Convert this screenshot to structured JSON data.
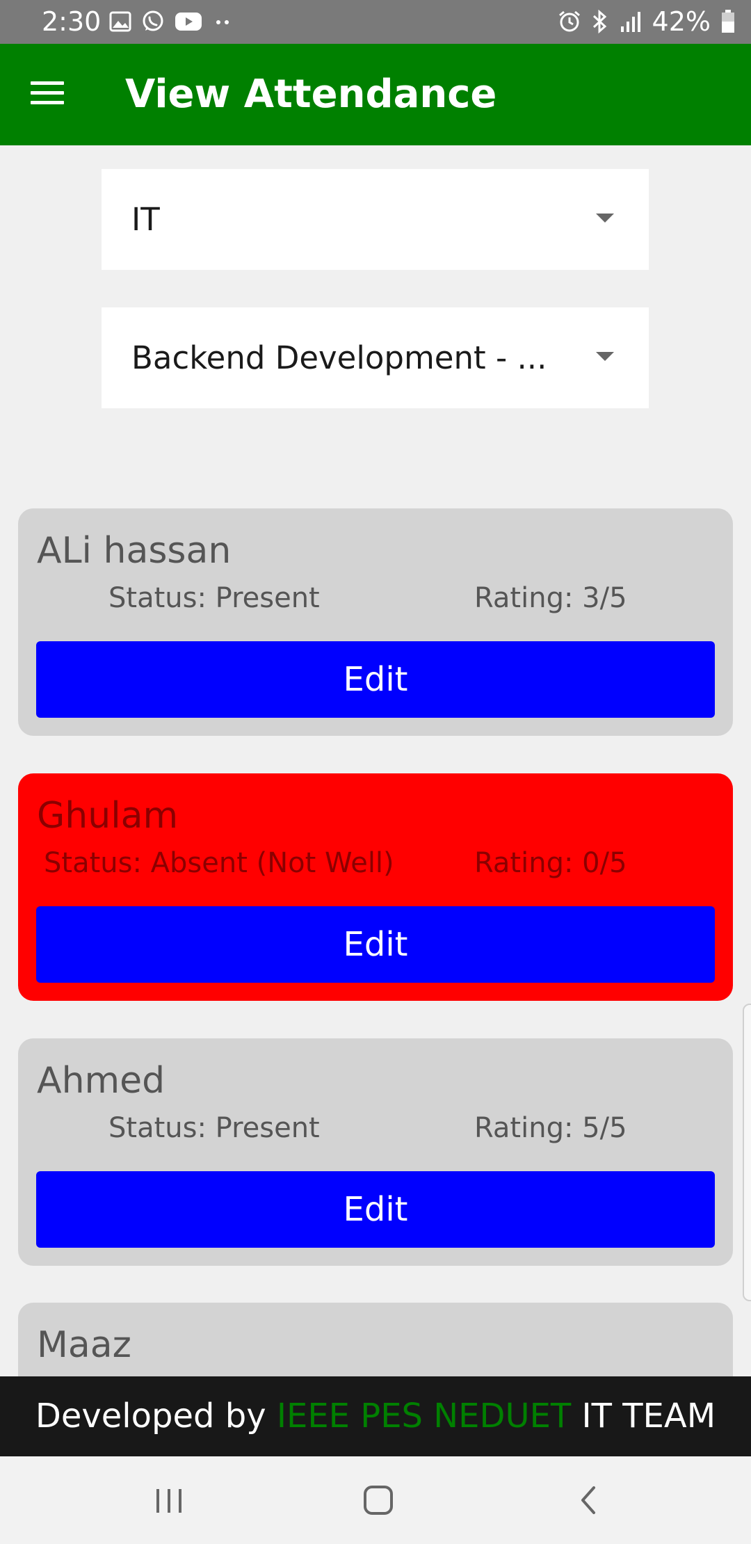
{
  "status_bar": {
    "time": "2:30",
    "battery": "42%",
    "left_icons": [
      "gallery-icon",
      "whatsapp-icon",
      "youtube-icon",
      "more-dots-icon"
    ],
    "right_icons": [
      "alarm-icon",
      "bluetooth-icon",
      "signal-icon",
      "battery-icon"
    ]
  },
  "app_bar": {
    "title": "View Attendance",
    "menu_icon": "hamburger-menu-icon",
    "color": "#008000"
  },
  "filters": {
    "department": {
      "selected": "IT"
    },
    "course": {
      "selected": "Backend Development  - ..."
    }
  },
  "records": [
    {
      "name": "ALi hassan",
      "status": "Status: Present",
      "rating": "Rating: 3/5",
      "edit_label": "Edit",
      "absent": false
    },
    {
      "name": "Ghulam",
      "status": "Status: Absent (Not Well)",
      "rating": "Rating: 0/5",
      "edit_label": "Edit",
      "absent": true
    },
    {
      "name": "Ahmed",
      "status": "Status: Present",
      "rating": "Rating: 5/5",
      "edit_label": "Edit",
      "absent": false
    },
    {
      "name": "Maaz"
    }
  ],
  "colors": {
    "card_default": "#d3d3d3",
    "card_absent": "#ff0000",
    "edit_button": "#0000ff",
    "footer_bg": "#181818",
    "footer_accent": "#008000"
  },
  "footer": {
    "prefix": "Developed by ",
    "highlight": "IEEE PES NEDUET",
    "suffix": " IT TEAM"
  },
  "nav_bar": {
    "buttons": [
      "recent-apps-icon",
      "home-icon",
      "back-icon"
    ]
  }
}
